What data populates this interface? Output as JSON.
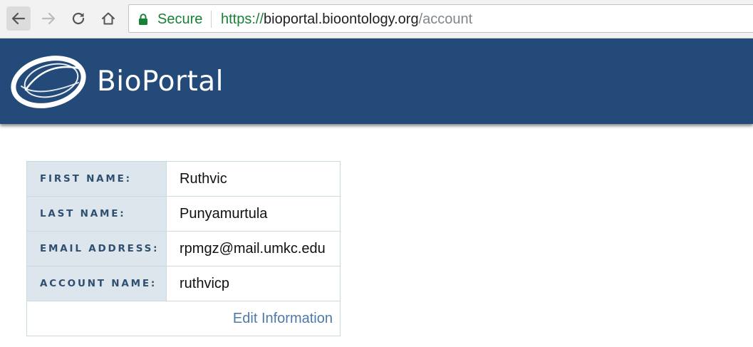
{
  "browser": {
    "secure_label": "Secure",
    "url_scheme": "https://",
    "url_host": "bioportal.bioontology.org",
    "url_path": "/account",
    "icons": [
      "back-arrow-icon",
      "forward-arrow-icon",
      "reload-icon",
      "home-icon",
      "lock-icon"
    ]
  },
  "header": {
    "logo_text": "BioPortal",
    "background_color": "#234a79"
  },
  "account": {
    "rows": [
      {
        "label": "FIRST NAME:",
        "value": "Ruthvic"
      },
      {
        "label": "LAST NAME:",
        "value": "Punyamurtula"
      },
      {
        "label": "EMAIL ADDRESS:",
        "value": "rpmgz@mail.umkc.edu"
      },
      {
        "label": "ACCOUNT NAME:",
        "value": "ruthvicp"
      }
    ],
    "edit_link": "Edit Information"
  },
  "colors": {
    "label_cell_bg": "#dde6ec",
    "label_text": "#2e4f70",
    "link": "#4d7aa8",
    "secure_green": "#188038"
  }
}
